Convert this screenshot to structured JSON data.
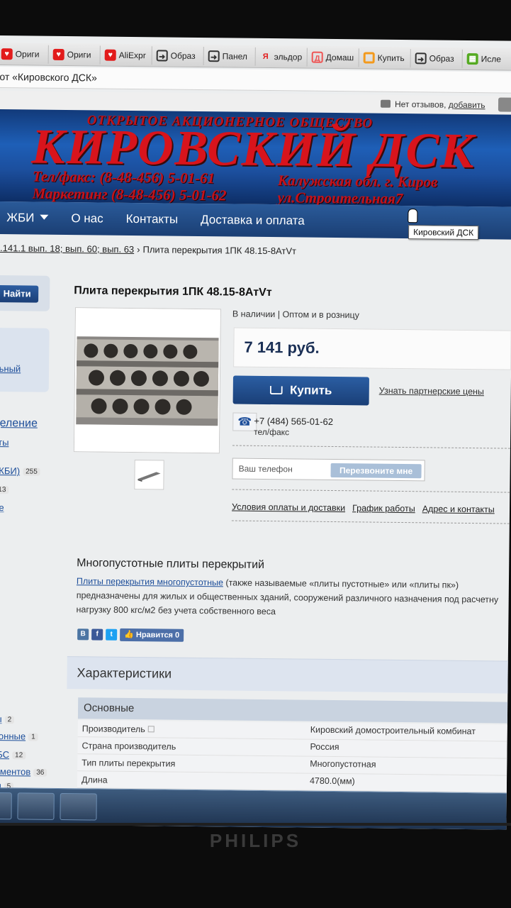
{
  "bookmarks": [
    {
      "label": "Ориги",
      "icon": "heart-icon"
    },
    {
      "label": "Ориги",
      "icon": "heart-icon"
    },
    {
      "label": "AliExpr",
      "icon": "heart-icon"
    },
    {
      "label": "Образ",
      "icon": "circle-arrow-icon"
    },
    {
      "label": "Панел",
      "icon": "circle-arrow-icon"
    },
    {
      "label": "эльдор",
      "icon": "yandex-icon"
    },
    {
      "label": "Домаш",
      "icon": "dom-icon"
    },
    {
      "label": "Купить",
      "icon": "ring-icon"
    },
    {
      "label": "Образ",
      "icon": "circle-arrow-icon"
    },
    {
      "label": "Исле",
      "icon": "film-icon"
    }
  ],
  "page_title": "от «Кировского ДСК»",
  "reviews": {
    "text": "Нет отзывов,",
    "link": "добавить"
  },
  "banner": {
    "top_line": "ОТКРЫТОЕ АКЦИОНЕРНОЕ ОБЩЕСТВО",
    "name": "КИРОВСКИЙ ДСК",
    "phone1": "Тел/факс:    (8-48-456) 5-01-61",
    "phone2": "Маркетинг (8-48-456) 5-01-62",
    "addr1": "Калужская обл. г. Киров",
    "addr2": "ул.Строительная7"
  },
  "nav": {
    "items": [
      "ЖБИ",
      "О нас",
      "Контакты",
      "Доставка и оплата"
    ]
  },
  "tooltip": "Кировский ДСК",
  "breadcrumb": {
    "link": "1.141.1 вып. 18; вып. 60; вып. 63",
    "sep": "›",
    "current": "Плита перекрытия 1ПК 48.15-8АтVт"
  },
  "sidebar": {
    "find_label": "Найти",
    "link1": "льный",
    "heading": "деление",
    "sub": "нты",
    "categories": [
      {
        "label": "(ЖБИ)",
        "count": "255"
      },
      {
        "label": "",
        "count": "13"
      },
      {
        "label": "ые",
        "count": ""
      }
    ],
    "bottom_categories": [
      {
        "label": "цы",
        "count": "2"
      },
      {
        "label": "стонные",
        "count": "1"
      },
      {
        "label": "ФБС",
        "count": "12"
      },
      {
        "label": "даментов",
        "count": "36"
      },
      {
        "label": "бы",
        "count": "5"
      }
    ]
  },
  "product": {
    "title": "Плита перекрытия 1ПК 48.15-8АтVт",
    "availability": "В наличии | Оптом и в розницу",
    "price": "7 141 руб.",
    "buy_label": "Купить",
    "partner_link": "Узнать партнерские цены",
    "phone": "+7 (484) 565-01-62",
    "phone_note": "тел/факс",
    "callback_placeholder": "Ваш телефон",
    "callback_button": "Перезвоните мне",
    "links": [
      "Условия оплаты и доставки",
      "График работы",
      "Адрес и контакты"
    ]
  },
  "description": {
    "title": "Многопустотные плиты перекрытий",
    "link": "Плиты перекрытия многопустотные",
    "text1": " (также называемые «плиты пустотные» или «плиты пк»)",
    "text2": "предназначены для жилых и общественных зданий, сооружений различного назначения под расчетну",
    "text3": "нагрузку 800 кгс/м2 без учета собственного веса"
  },
  "social": {
    "vk": "В",
    "fb": "f",
    "tw": "t",
    "like": "Нравится 0"
  },
  "characteristics": {
    "title": "Характеристики",
    "section": "Основные",
    "rows": [
      {
        "key": "Производитель",
        "value": "Кировский домостроительный комбинат"
      },
      {
        "key": "Страна производитель",
        "value": "Россия"
      },
      {
        "key": "Тип плиты перекрытия",
        "value": "Многопустотная"
      },
      {
        "key": "Длина",
        "value": "4780.0(мм)"
      }
    ]
  },
  "monitor_brand": "PHILIPS",
  "colors": {
    "nav": "#1f4a87",
    "accent": "#d8141c",
    "link": "#1d4e9a",
    "button": "#2b5ea3"
  }
}
